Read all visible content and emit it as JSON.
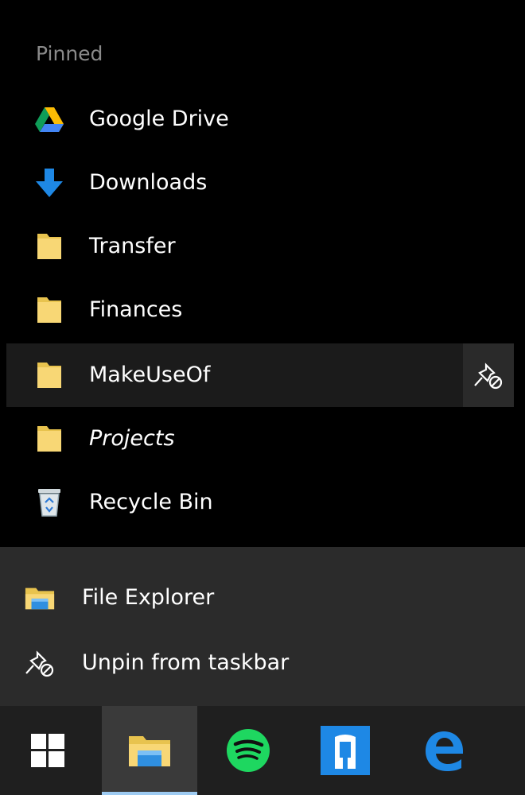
{
  "jumplist": {
    "section_header": "Pinned",
    "pinned_items": [
      {
        "label": "Google Drive",
        "icon": "google-drive-icon",
        "italic": false
      },
      {
        "label": "Downloads",
        "icon": "download-arrow-icon",
        "italic": false
      },
      {
        "label": "Transfer",
        "icon": "folder-icon",
        "italic": false
      },
      {
        "label": "Finances",
        "icon": "folder-icon",
        "italic": false
      },
      {
        "label": "MakeUseOf",
        "icon": "folder-icon",
        "italic": false,
        "hovered": true,
        "action_icon": "unpin-icon"
      },
      {
        "label": "Projects",
        "icon": "folder-icon",
        "italic": true
      },
      {
        "label": "Recycle Bin",
        "icon": "recycle-bin-icon",
        "italic": false
      }
    ],
    "tasks": [
      {
        "label": "File Explorer",
        "icon": "file-explorer-icon"
      },
      {
        "label": "Unpin from taskbar",
        "icon": "unpin-icon"
      }
    ]
  },
  "taskbar": {
    "buttons": [
      {
        "name": "windows-start-icon",
        "active": false
      },
      {
        "name": "file-explorer-icon",
        "active": true
      },
      {
        "name": "spotify-icon",
        "active": false
      },
      {
        "name": "mail-app-icon",
        "active": false
      },
      {
        "name": "edge-browser-icon",
        "active": false
      }
    ]
  },
  "colors": {
    "background": "#000000",
    "tasks_background": "#2b2b2b",
    "taskbar_background": "#1f1f1f",
    "hover_background": "#1b1b1b",
    "folder_yellow": "#f8d775",
    "accent_blue": "#1e88e5",
    "spotify_green": "#1ed760"
  }
}
